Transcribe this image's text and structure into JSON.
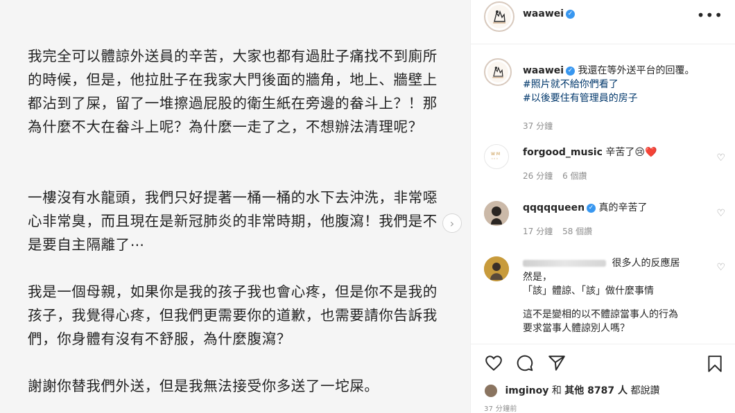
{
  "post": {
    "paragraphs": [
      "我完全可以體諒外送員的辛苦，大家也都有過肚子痛找不到廁所的時候，但是，他拉肚子在我家大門後面的牆角，地上、牆壁上都沾到了屎，留了一堆擦過屁股的衛生紙在旁邊的畚斗上？！那為什麼不大在畚斗上呢？為什麼一走了之，不想辦法清理呢？",
      "一樓沒有水龍頭，我們只好提著一桶一桶的水下去沖洗，非常噁心非常臭，而且現在是新冠肺炎的非常時期，他腹瀉！我們是不是要自主隔離了⋯",
      "我是一個母親，如果你是我的孩子我也會心疼，但是你不是我的孩子，我覺得心疼，但我們更需要你的道歉，也需要請你告訴我們，你身體有沒有不舒服，為什麼腹瀉？",
      "謝謝你替我們外送，但是我無法接受你多送了一坨屎。"
    ],
    "next_icon": "chevron-right-icon"
  },
  "header": {
    "username": "waawei",
    "verified_icon": "verified-badge-icon",
    "more_icon": "more-dots-icon"
  },
  "caption": {
    "username": "waawei",
    "text": "我還在等外送平台的回覆。",
    "hashtag1": "#照片就不給你們看了",
    "hashtag2": "#以後要住有管理員的房子",
    "time": "37 分鐘"
  },
  "comments": [
    {
      "username": "forgood_music",
      "text": "辛苦了😢❤️",
      "time": "26 分鐘",
      "likes": "6 個讚"
    },
    {
      "username": "qqqqqueen",
      "text": "真的辛苦了",
      "time": "17 分鐘",
      "likes": "58 個讚"
    },
    {
      "text_line1": "很多人的反應居",
      "text_line2": "然是，",
      "text_line3": "「該」體諒、「該」做什麼事情",
      "text_line4": "這不是變相的以不體諒當事人的行為",
      "text_line5": "要求當事人體諒別人嗎？"
    }
  ],
  "actions": {
    "like_icon": "heart-icon",
    "comment_icon": "comment-icon",
    "share_icon": "paper-plane-icon",
    "save_icon": "bookmark-icon"
  },
  "likes": {
    "liker": "imginoy",
    "and_text": "和",
    "others": "其他 8787 人",
    "suffix": "都說讚"
  },
  "time_ago": "37 分鐘前",
  "colors": {
    "link": "#00376b",
    "verified": "#3897f0",
    "meta": "#8e8e8e"
  }
}
